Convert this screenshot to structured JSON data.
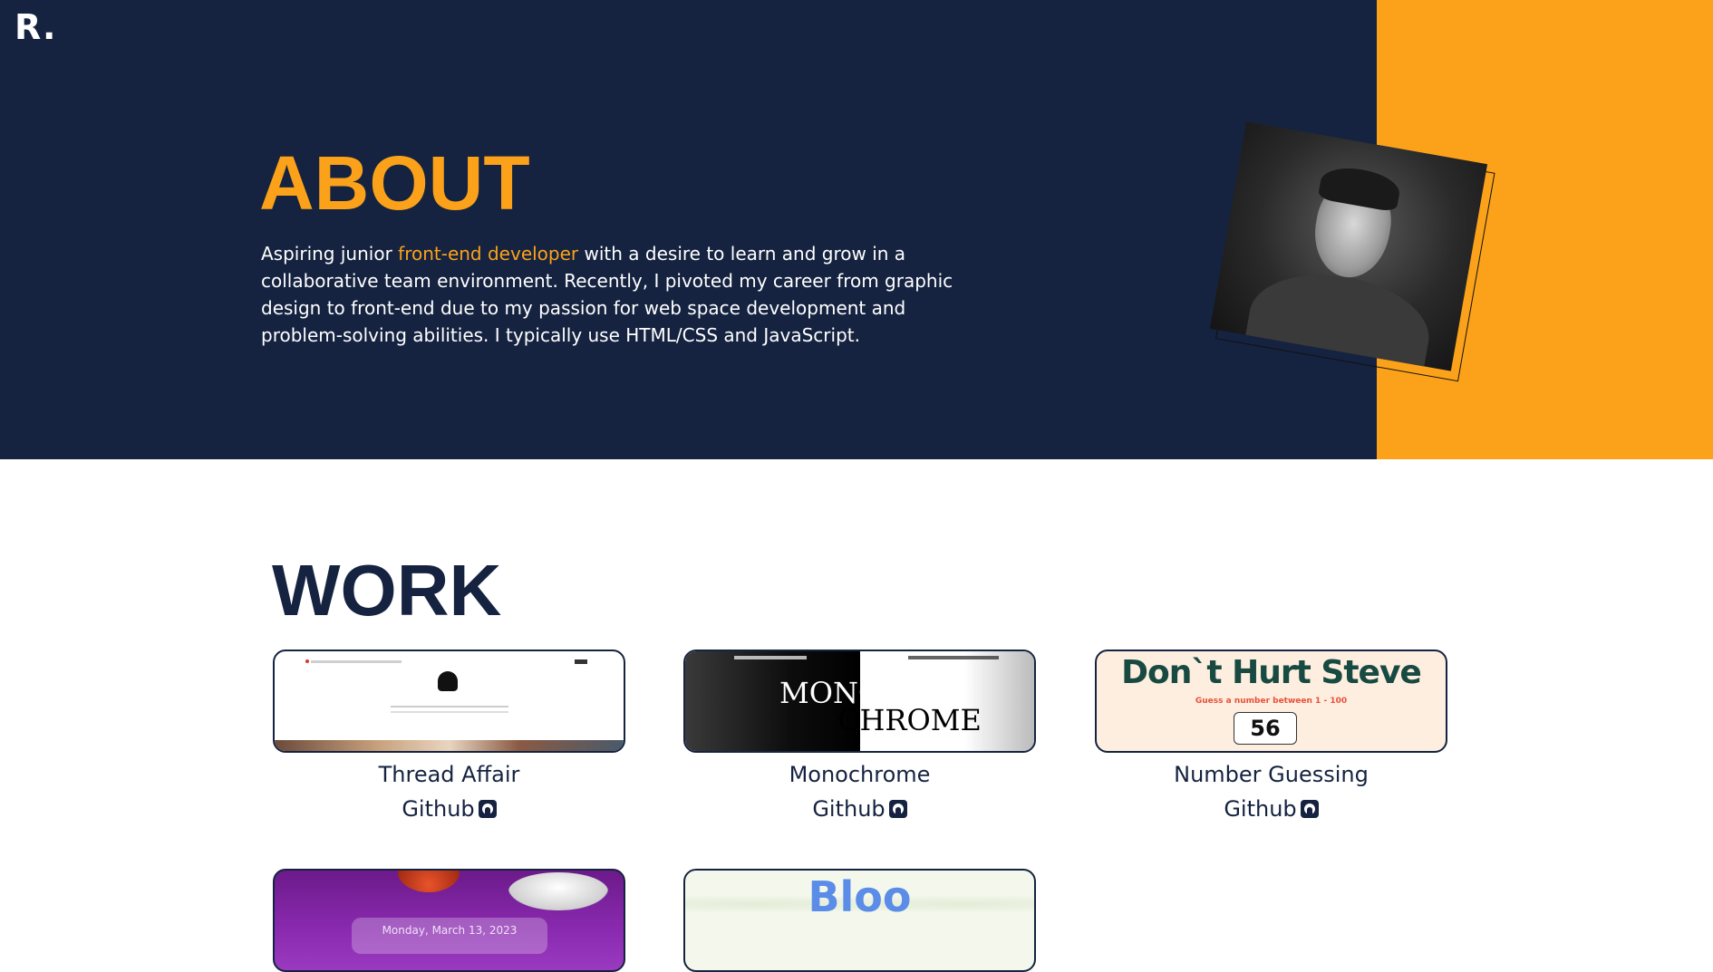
{
  "logo": "R.",
  "about": {
    "title": "ABOUT",
    "text_before": "Aspiring junior ",
    "highlight": "front-end developer",
    "text_after": " with a desire to learn and grow in a collaborative team environment. Recently, I pivoted my career from graphic design to front-end due to my passion for web space development and problem-solving abilities. I typically use HTML/CSS and JavaScript."
  },
  "work": {
    "title": "WORK",
    "projects": [
      {
        "name": "Thread Affair",
        "link_label": "Github",
        "icon": "github-icon"
      },
      {
        "name": "Monochrome",
        "link_label": "Github",
        "icon": "github-icon",
        "thumb_line1": "MONO",
        "thumb_line2": "CHROME"
      },
      {
        "name": "Number Guessing",
        "link_label": "Github",
        "icon": "github-icon",
        "thumb_title": "Don`t Hurt Steve",
        "thumb_sub": "Guess a number between 1 - 100",
        "thumb_value": "56"
      },
      {
        "thumb_text": "Monday, March 13, 2023"
      },
      {
        "thumb_title": "Bloo"
      }
    ]
  },
  "colors": {
    "navy": "#152340",
    "accent": "#fba21a"
  }
}
